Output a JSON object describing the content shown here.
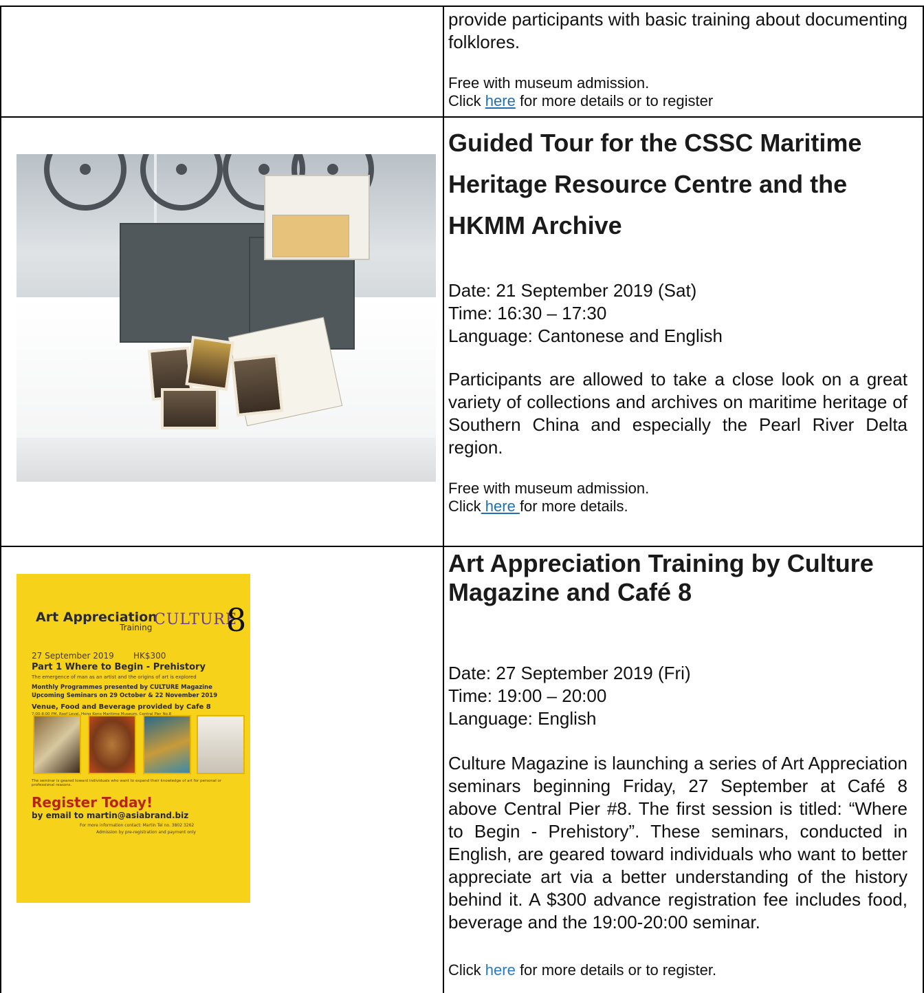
{
  "row1": {
    "body": "provide participants with basic training about documenting folklores.",
    "admission": "Free with museum admission.",
    "click_prefix": "Click ",
    "link": "here",
    "click_suffix": " for more details or to register"
  },
  "row2": {
    "title_lines": [
      "Guided Tour for the CSSC Maritime",
      "Heritage Resource Centre and the",
      "HKMM Archive"
    ],
    "date": "Date: 21 September 2019 (Sat)",
    "time": "Time: 16:30 – 17:30",
    "language": "Language: Cantonese and English",
    "body": "Participants are allowed to take a close look on a great variety of collections and archives on maritime heritage of Southern China and especially the Pearl River Delta region.",
    "admission": "Free with museum admission.",
    "click_prefix": "Click",
    "link": " here ",
    "click_suffix": "for more details."
  },
  "row3": {
    "title_lines": [
      "Art Appreciation Training by Culture",
      "Magazine and Café 8"
    ],
    "date": "Date: 27 September 2019 (Fri)",
    "time": "Time: 19:00 – 20:00",
    "language": "Language: English",
    "body": "Culture Magazine is launching a series of Art Appreciation seminars beginning Friday, 27 September at Café 8 above Central Pier #8. The first session is titled: “Where to Begin - Prehistory”. These seminars, conducted in English, are geared toward individuals who want to better appreciate art via a better understanding of the history behind it. A $300 advance registration fee includes food, beverage and the 19:00-20:00 seminar.",
    "click_prefix": "Click ",
    "link": "here",
    "click_suffix": " for more details or to register."
  },
  "poster": {
    "title": "Art Appreciation",
    "subtitle": "Training",
    "brand": "CULTURE",
    "number": "8",
    "date": "27 September 2019",
    "price": "HK$300",
    "part": "Part 1 Where to Begin - Prehistory",
    "part_sub": "The emergence of man as an artist and the origins of art is explored",
    "monthly": "Monthly Programmes presented by CULTURE Magazine",
    "upcoming": "Upcoming Seminars on 29 October & 22 November 2019",
    "venue": "Venue, Food and Beverage provided by Cafe 8",
    "venue_sub": "7:00-8:00 PM, Roof Level, Hong Kong Maritime Museum, Central Pier No.8",
    "geared": "The seminar is geared toward individuals who want to expand their knowledge of art for personal or professional reasons.",
    "register": "Register Today!",
    "email": "by email to martin@asiabrand.biz",
    "contact": "For more information contact: Martin Tel no. 3802 3262",
    "admission": "Admission by pre-registration and payment only"
  }
}
